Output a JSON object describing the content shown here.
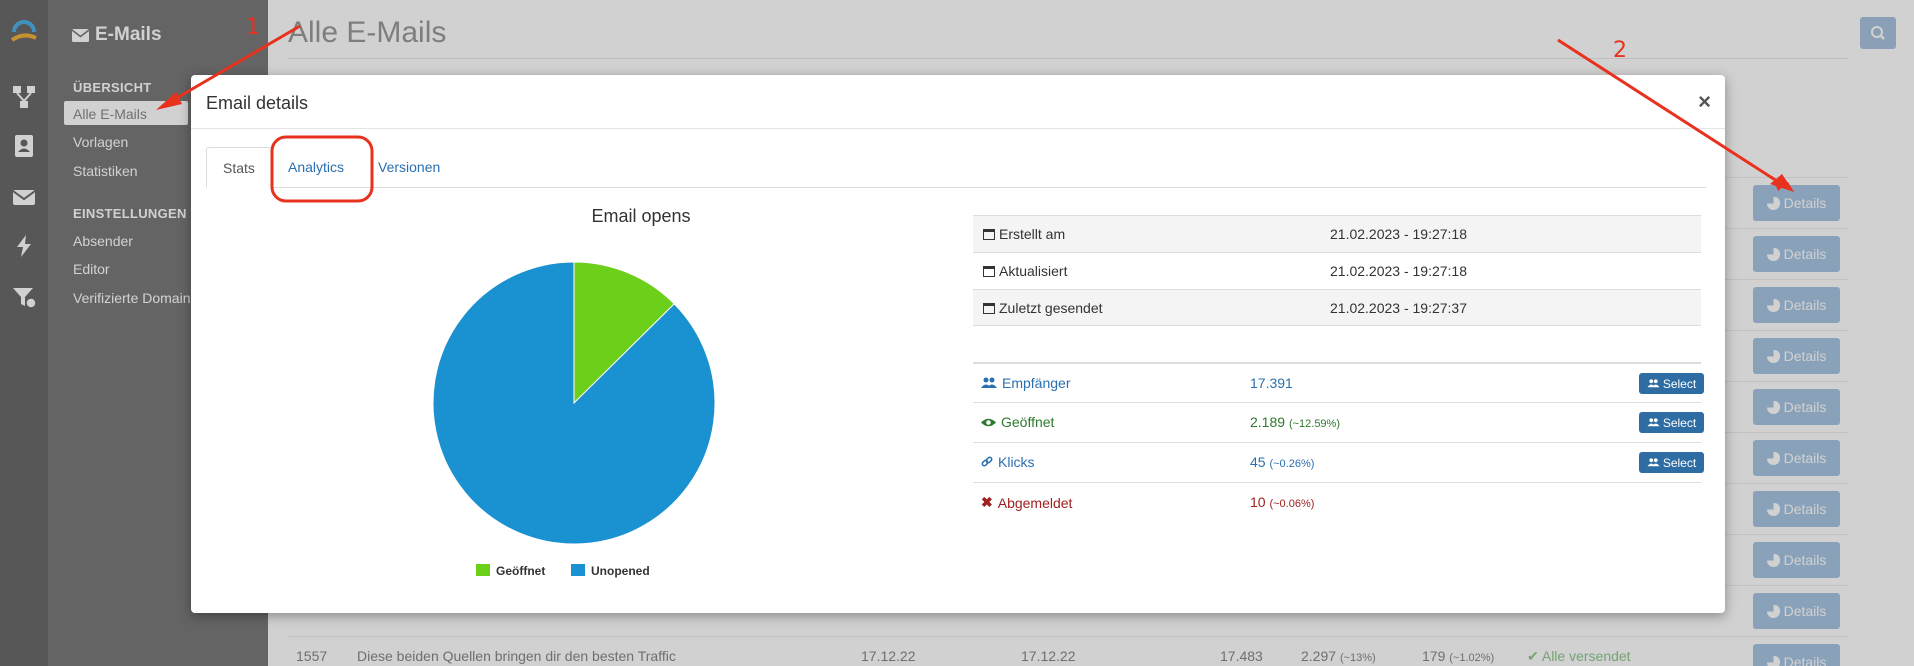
{
  "rail": {
    "icons": [
      "app-logo-icon",
      "flow-icon",
      "contacts-icon",
      "envelope-icon",
      "lightning-icon",
      "funnel-icon"
    ]
  },
  "sidebar": {
    "title": "E-Mails",
    "section_overview": "ÜBERSICHT",
    "items_overview": [
      "Alle E-Mails",
      "Vorlagen",
      "Statistiken"
    ],
    "section_settings": "EINSTELLUNGEN",
    "items_settings": [
      "Absender",
      "Editor",
      "Verifizierte Domains"
    ]
  },
  "main": {
    "title": "Alle E-Mails",
    "details_label": "Details",
    "bottom_row": {
      "id": "1557",
      "subject": "Diese beiden Quellen bringen dir den besten Traffic",
      "created": "17.12.22",
      "sent": "17.12.22",
      "recipients": "17.483",
      "opened": "2.297",
      "opened_pct": "(~13%)",
      "clicks": "179",
      "clicks_pct": "(~1.02%)",
      "status": "Alle versendet"
    }
  },
  "modal": {
    "title": "Email details",
    "close": "×",
    "tabs": [
      "Stats",
      "Analytics",
      "Versionen"
    ],
    "chart_title": "Email opens",
    "info": [
      {
        "label": "Erstellt am",
        "value": "21.02.2023 - 19:27:18"
      },
      {
        "label": "Aktualisiert",
        "value": "21.02.2023 - 19:27:18"
      },
      {
        "label": "Zuletzt gesendet",
        "value": "21.02.2023 - 19:27:37"
      }
    ],
    "stats": [
      {
        "label": "Empfänger",
        "value": "17.391",
        "pct": "",
        "color": "#2a6fb0"
      },
      {
        "label": "Geöffnet",
        "value": "2.189",
        "pct": "(~12.59%)",
        "color": "#2d7a2d"
      },
      {
        "label": "Klicks",
        "value": "45",
        "pct": "(~0.26%)",
        "color": "#2a6fb0"
      },
      {
        "label": "Abgemeldet",
        "value": "10",
        "pct": "(~0.06%)",
        "color": "#a02020"
      }
    ],
    "select_label": "Select"
  },
  "chart_data": {
    "type": "pie",
    "title": "Email opens",
    "categories": [
      "Geöffnet",
      "Unopened"
    ],
    "values": [
      2189,
      15202
    ],
    "colors": [
      "#6ccf1a",
      "#1a91d1"
    ],
    "legend": "bottom"
  },
  "annotations": [
    "1",
    "2"
  ]
}
